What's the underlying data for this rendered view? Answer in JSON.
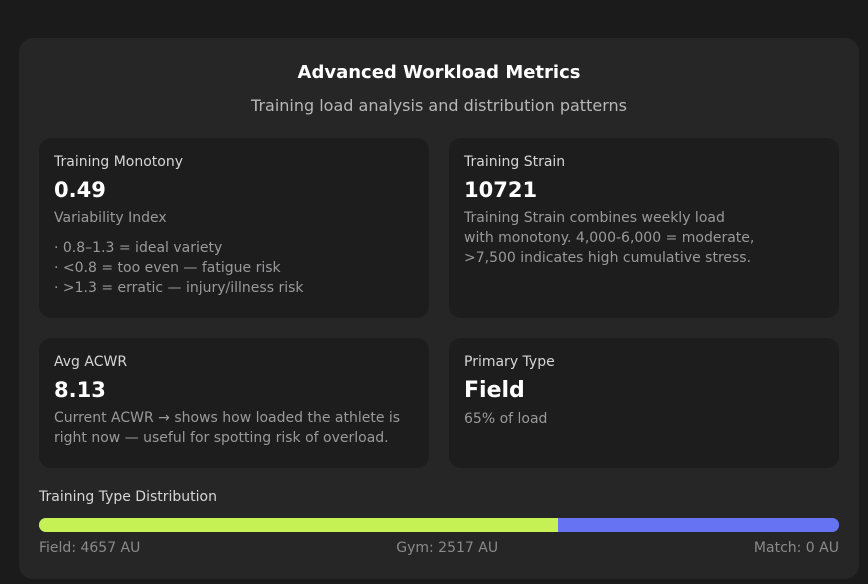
{
  "header": {
    "title": "Advanced Workload Metrics",
    "subtitle": "Training load analysis and distribution patterns"
  },
  "cards": {
    "monotony": {
      "label": "Training Monotony",
      "value": "0.49",
      "sub": "Variability Index",
      "bullets": [
        "· 0.8–1.3 = ideal variety",
        "· <0.8 = too even — fatigue risk",
        "· >1.3 = erratic — injury/illness risk"
      ]
    },
    "strain": {
      "label": "Training Strain",
      "value": "10721",
      "desc_lines": [
        "Training Strain combines weekly load",
        "with monotony. 4,000-6,000 = moderate,",
        ">7,500 indicates high cumulative stress."
      ]
    },
    "acwr": {
      "label": "Avg ACWR",
      "value": "8.13",
      "desc_lines": [
        "Current ACWR → shows how loaded the athlete is",
        "right now — useful for spotting risk of overload."
      ]
    },
    "primary": {
      "label": "Primary Type",
      "value": "Field",
      "desc": "65% of load"
    }
  },
  "distribution": {
    "label": "Training Type Distribution",
    "field": {
      "text": "Field: 4657 AU",
      "au": 4657,
      "color": "#c6f155"
    },
    "gym": {
      "text": "Gym: 2517 AU",
      "au": 2517,
      "color": "#6674f4"
    },
    "match": {
      "text": "Match: 0 AU",
      "au": 0,
      "color": "#ef6b6b"
    }
  },
  "colors": {
    "background": "#1b1b1c",
    "panel": "#262627",
    "card": "#1d1d1e"
  }
}
